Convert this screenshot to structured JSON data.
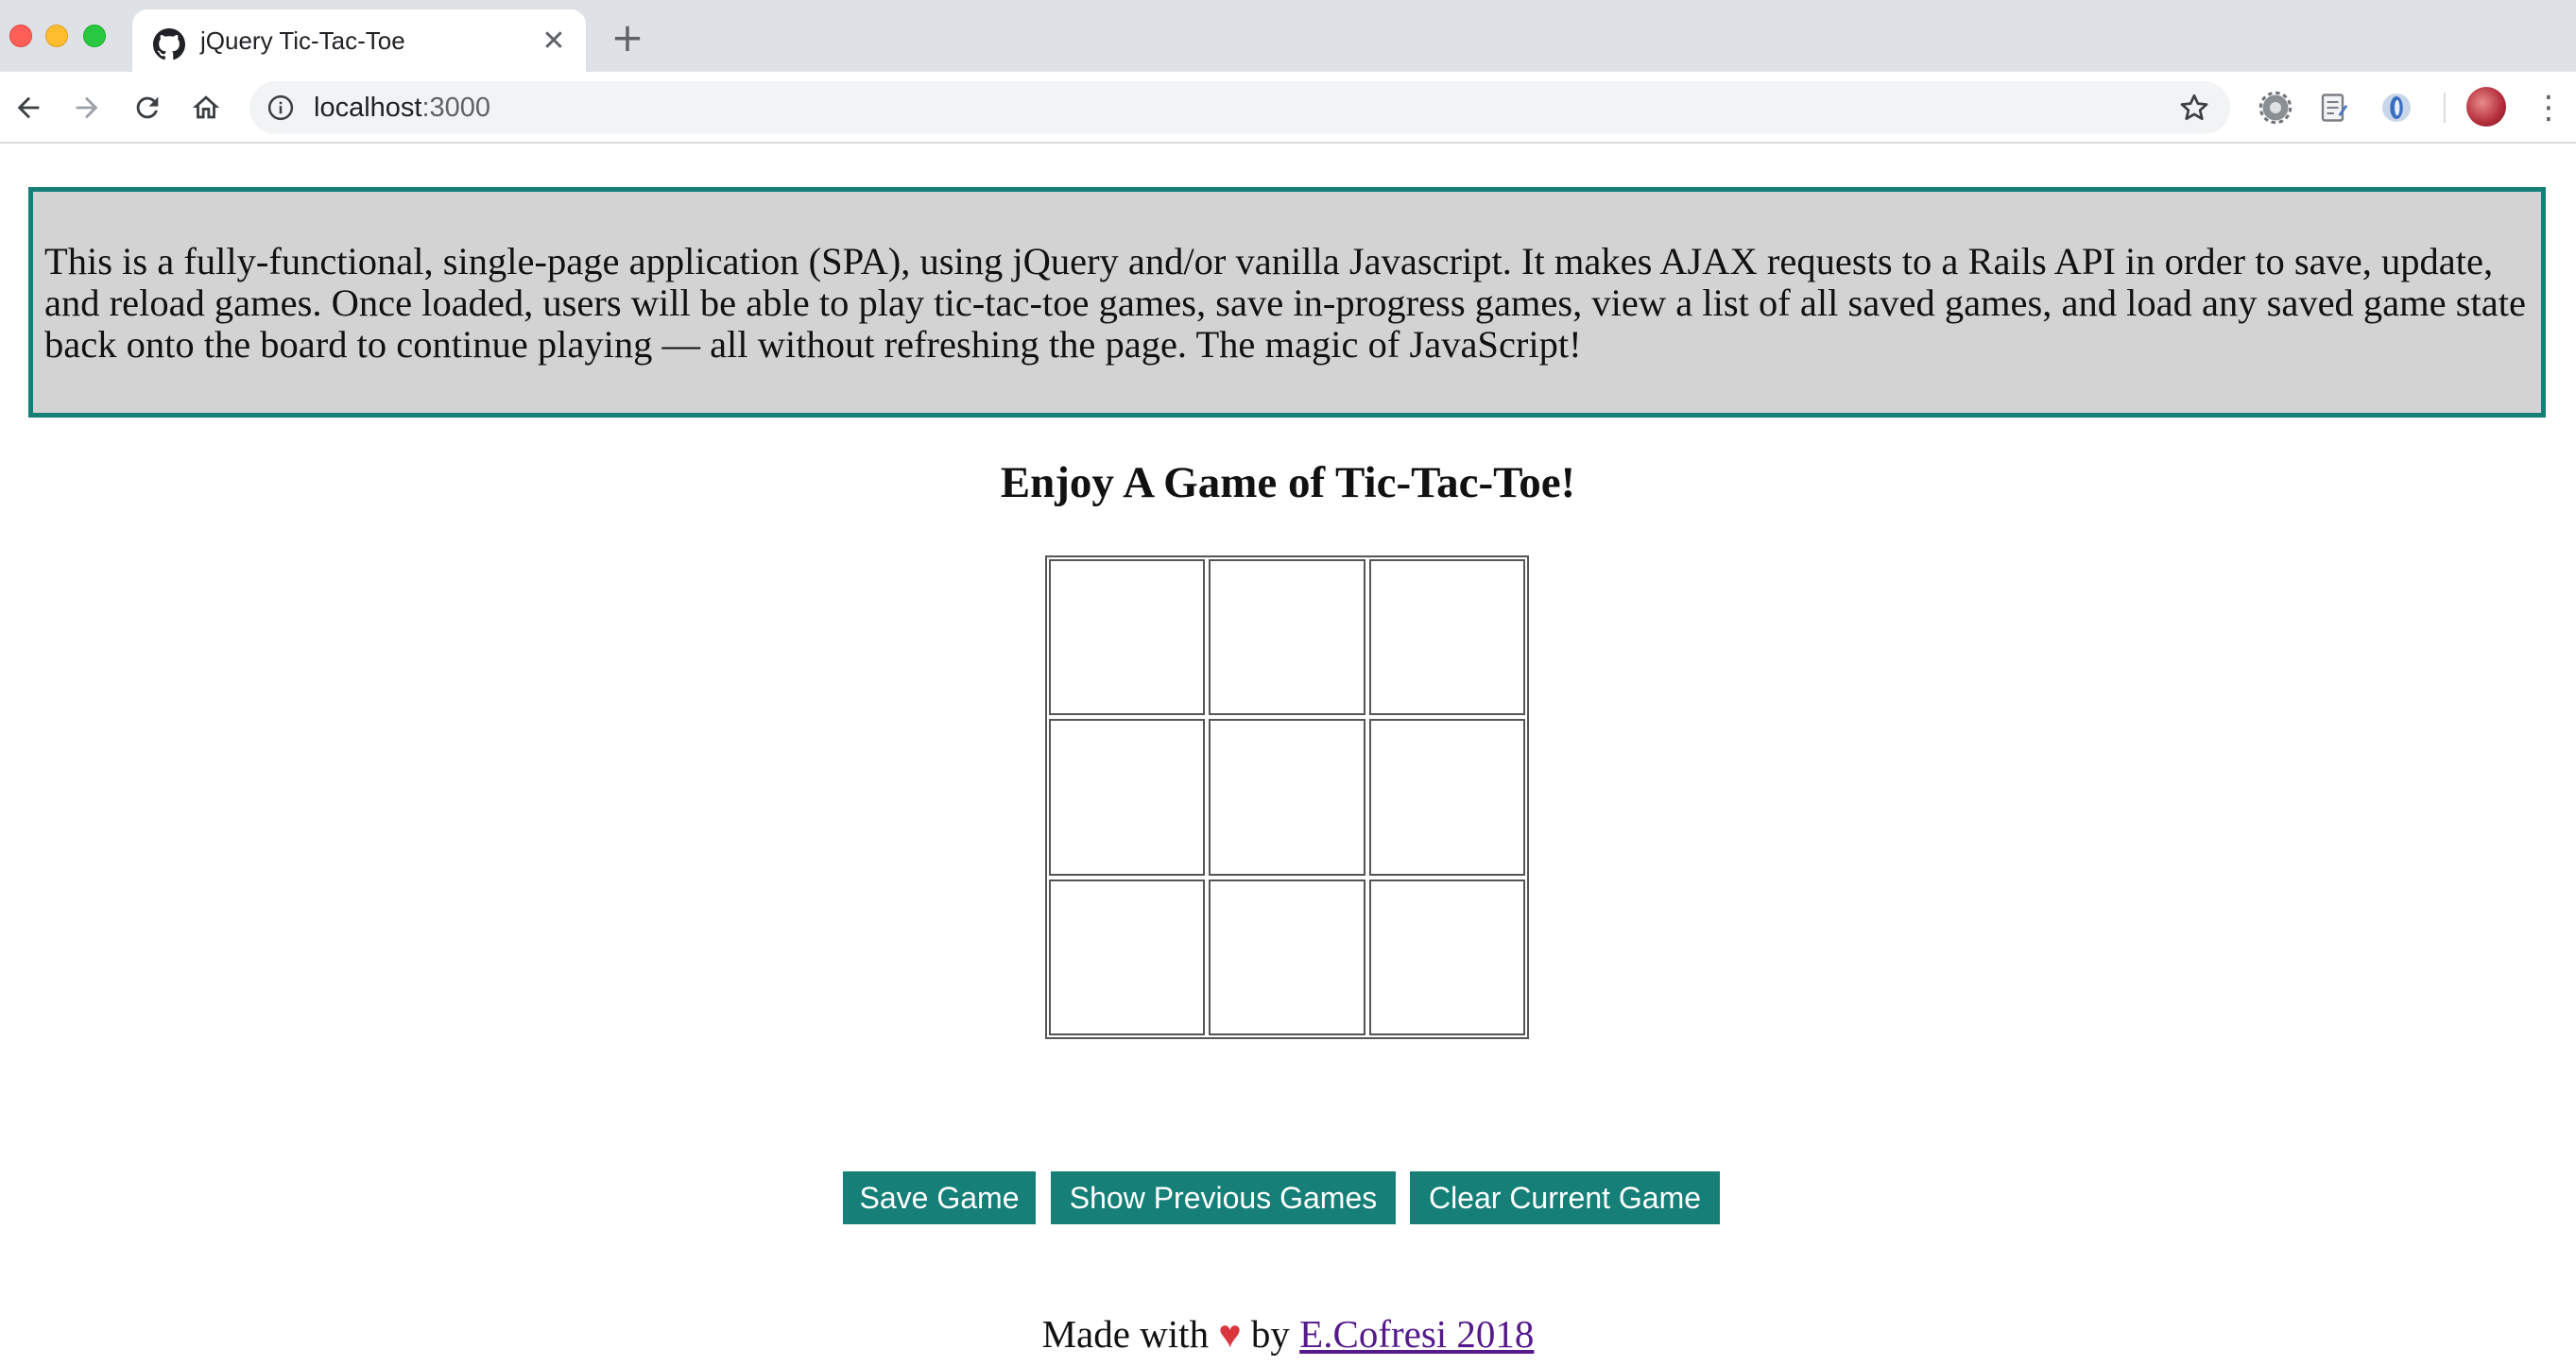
{
  "browser": {
    "tab": {
      "title": "jQuery Tic-Tac-Toe",
      "favicon": "github-icon",
      "close": "✕"
    },
    "new_tab": "+",
    "address_bar": {
      "host": "localhost",
      "port": ":3000"
    },
    "menu": "⋮"
  },
  "intro": {
    "text": "This is a fully-functional, single-page application (SPA), using jQuery and/or vanilla Javascript. It makes AJAX requests to a Rails API in order to save, update, and reload games. Once loaded, users will be able to play tic-tac-toe games, save in-progress games, view a list of all saved games, and load any saved game state back onto the board to continue playing — all without refreshing the page. The magic of JavaScript!"
  },
  "page": {
    "title": "Enjoy A Game of Tic-Tac-Toe!"
  },
  "board": {
    "cells": [
      "",
      "",
      "",
      "",
      "",
      "",
      "",
      "",
      ""
    ]
  },
  "buttons": {
    "save": "Save Game",
    "previous": "Show Previous Games",
    "clear": "Clear Current Game"
  },
  "footer": {
    "prefix": "Made with",
    "heart": "♥",
    "middle": "by",
    "author_link": "E.Cofresi 2018"
  },
  "colors": {
    "accent": "#167f78",
    "intro_background": "#d3d3d3",
    "heart": "#d9363e",
    "link": "#551a8b"
  }
}
